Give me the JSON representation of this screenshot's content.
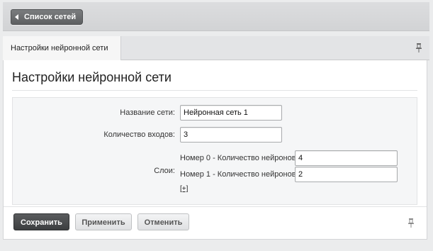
{
  "toolbar": {
    "back_label": "Список сетей"
  },
  "tabs": [
    {
      "label": "Настройки нейронной сети"
    }
  ],
  "page": {
    "title": "Настройки нейронной сети"
  },
  "form": {
    "name_label": "Название сети:",
    "name_value": "Нейронная сеть 1",
    "inputs_label": "Количество входов:",
    "inputs_value": "3",
    "layers_label": "Слои:",
    "layers": [
      {
        "label": "Номер 0 - Количество нейронов:",
        "value": "4"
      },
      {
        "label": "Номер 1 - Количество нейронов:",
        "value": "2"
      }
    ],
    "add_layer_label": "[+]"
  },
  "buttons": {
    "save": "Сохранить",
    "apply": "Применить",
    "cancel": "Отменить"
  },
  "icons": {
    "pin": "pin-icon",
    "back": "arrow-left-icon"
  },
  "colors": {
    "primary_button": "#4a4c4e",
    "background": "#ebeced"
  }
}
